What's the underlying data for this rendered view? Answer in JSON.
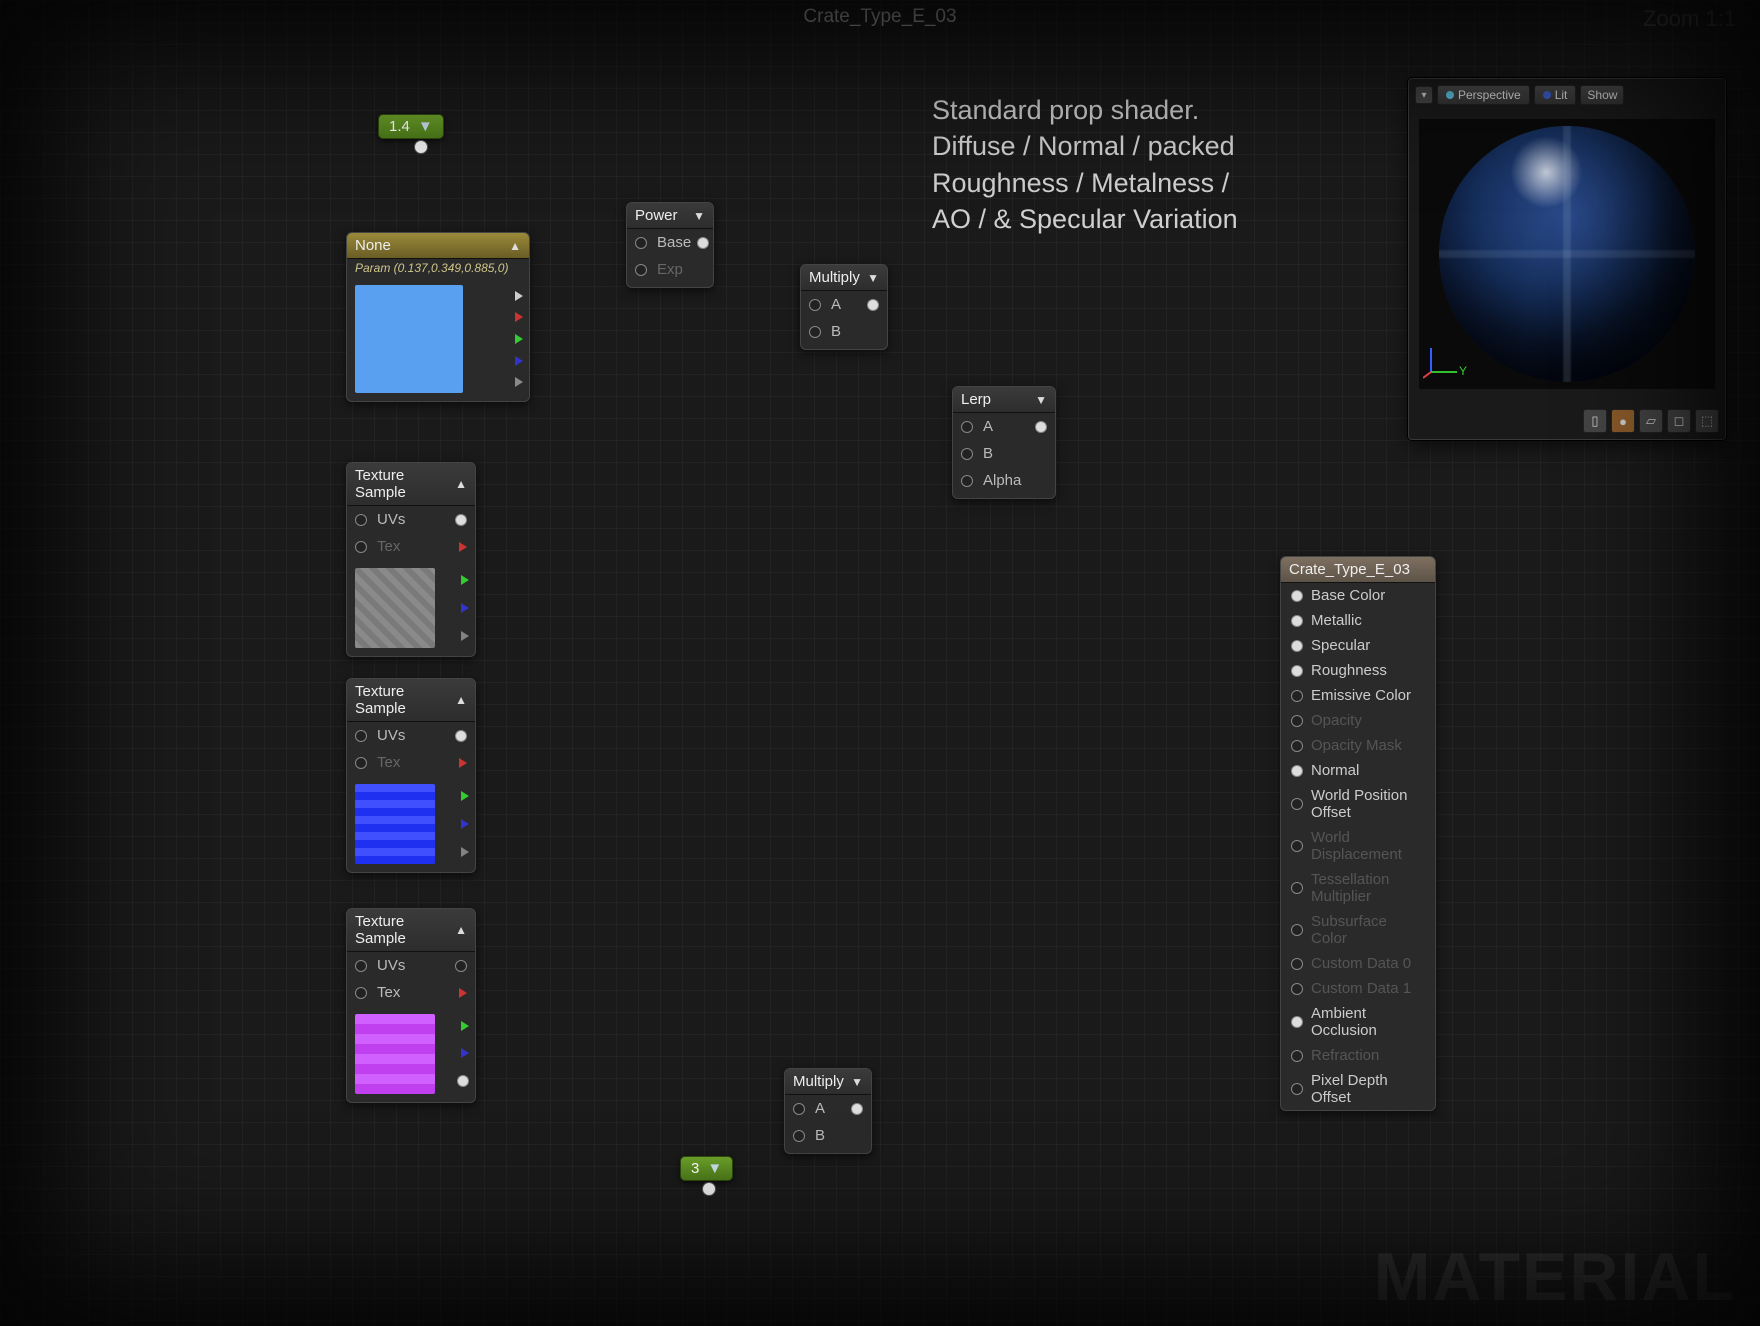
{
  "title": "Crate_Type_E_03",
  "zoom": "Zoom 1:1",
  "annotation": "Standard prop shader.\nDiffuse / Normal / packed\nRoughness / Metalness /\nAO / & Specular Variation",
  "watermark": "MATERIAL",
  "pills": {
    "p14": "1.4",
    "p3": "3"
  },
  "nodes": {
    "none": {
      "title": "None",
      "sub": "Param (0.137,0.349,0.885,0)"
    },
    "power": {
      "title": "Power",
      "in1": "Base",
      "in2": "Exp"
    },
    "mult1": {
      "title": "Multiply",
      "in1": "A",
      "in2": "B"
    },
    "mult2": {
      "title": "Multiply",
      "in1": "A",
      "in2": "B"
    },
    "lerp": {
      "title": "Lerp",
      "in1": "A",
      "in2": "B",
      "in3": "Alpha"
    },
    "ts1": {
      "title": "Texture Sample",
      "uv": "UVs",
      "tex": "Tex"
    },
    "ts2": {
      "title": "Texture Sample",
      "uv": "UVs",
      "tex": "Tex"
    },
    "ts3": {
      "title": "Texture Sample",
      "uv": "UVs",
      "tex": "Tex"
    }
  },
  "output": {
    "title": "Crate_Type_E_03",
    "rows": [
      {
        "label": "Base Color",
        "connected": true
      },
      {
        "label": "Metallic",
        "connected": true
      },
      {
        "label": "Specular",
        "connected": true
      },
      {
        "label": "Roughness",
        "connected": true
      },
      {
        "label": "Emissive Color",
        "open": true
      },
      {
        "label": "Opacity",
        "dim": true
      },
      {
        "label": "Opacity Mask",
        "dim": true
      },
      {
        "label": "Normal",
        "connected": true
      },
      {
        "label": "World Position Offset",
        "open": true
      },
      {
        "label": "World Displacement",
        "dim": true
      },
      {
        "label": "Tessellation Multiplier",
        "dim": true
      },
      {
        "label": "Subsurface Color",
        "dim": true
      },
      {
        "label": "Custom Data 0",
        "dim": true
      },
      {
        "label": "Custom Data 1",
        "dim": true
      },
      {
        "label": "Ambient Occlusion",
        "connected": true
      },
      {
        "label": "Refraction",
        "dim": true
      },
      {
        "label": "Pixel Depth Offset",
        "open": true
      }
    ]
  },
  "preview": {
    "perspective": "Perspective",
    "lit": "Lit",
    "show": "Show",
    "axisY": "Y"
  }
}
